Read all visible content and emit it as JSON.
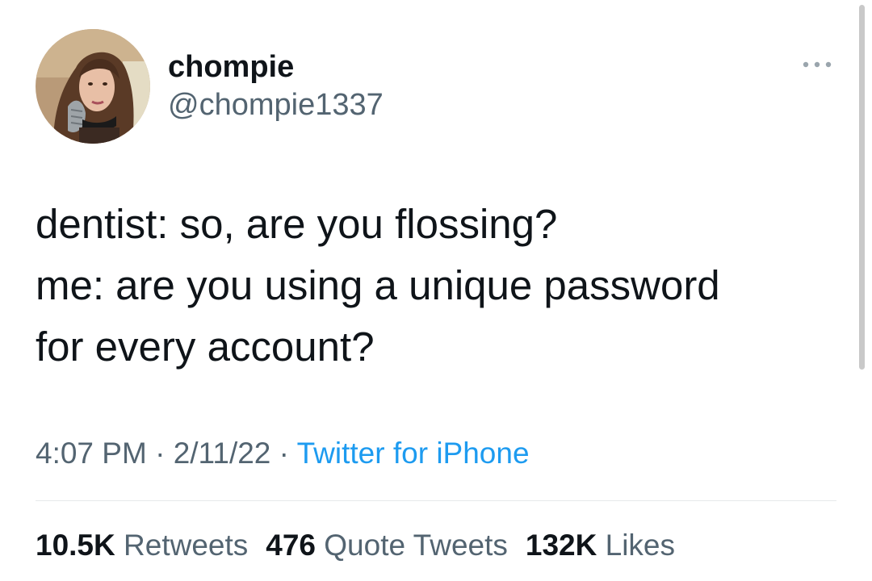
{
  "author": {
    "display_name": "chompie",
    "handle": "@chompie1337",
    "avatar_icon": "profile-photo"
  },
  "more_icon": "more-horizontal-icon",
  "tweet": {
    "text": "dentist: so, are you flossing?\nme: are you using a unique password\nfor every account?"
  },
  "meta": {
    "time": "4:07 PM",
    "separator": "·",
    "date": "2/11/22",
    "source": "Twitter for iPhone"
  },
  "stats": {
    "retweets_count": "10.5K",
    "retweets_label": "Retweets",
    "quotes_count": "476",
    "quotes_label": "Quote Tweets",
    "likes_count": "132K",
    "likes_label": "Likes"
  },
  "colors": {
    "text_primary": "#0f1419",
    "text_secondary": "#536471",
    "link_blue": "#1d9bf0",
    "divider": "#e6e9eb"
  }
}
